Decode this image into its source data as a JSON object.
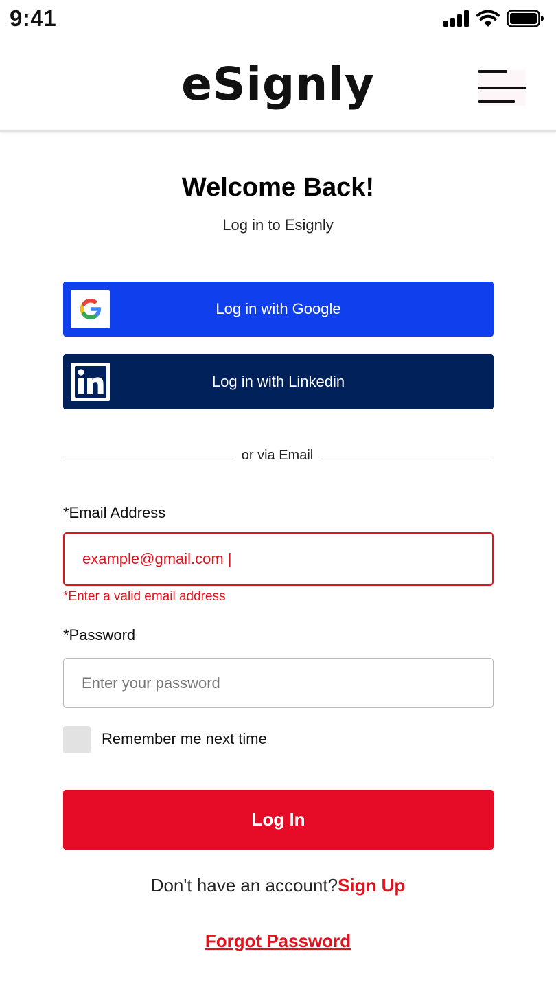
{
  "status_bar": {
    "time": "9:41"
  },
  "header": {
    "logo": "eSignly",
    "menu_icon": "hamburger-menu-icon"
  },
  "main": {
    "title": "Welcome Back!",
    "subtitle": "Log in to Esignly",
    "google_button": {
      "label": "Log in with Google",
      "icon": "google-icon",
      "color": "#1040ee"
    },
    "linkedin_button": {
      "label": "Log in with Linkedin",
      "icon": "linkedin-icon",
      "color": "#00215a"
    },
    "divider_text": "or via Email"
  },
  "form": {
    "email_label": "*Email Address",
    "email_value": "example@gmail.com |",
    "email_error": "*Enter a valid email address",
    "password_label": "*Password",
    "password_placeholder": "Enter your password",
    "remember_label": "Remember me next time",
    "login_button": "Log In",
    "signup_prompt": "Don't have an account?",
    "signup_link": "Sign Up",
    "forgot_password": "Forgot Password"
  },
  "colors": {
    "accent": "#e60c27",
    "error": "#e0141e"
  }
}
